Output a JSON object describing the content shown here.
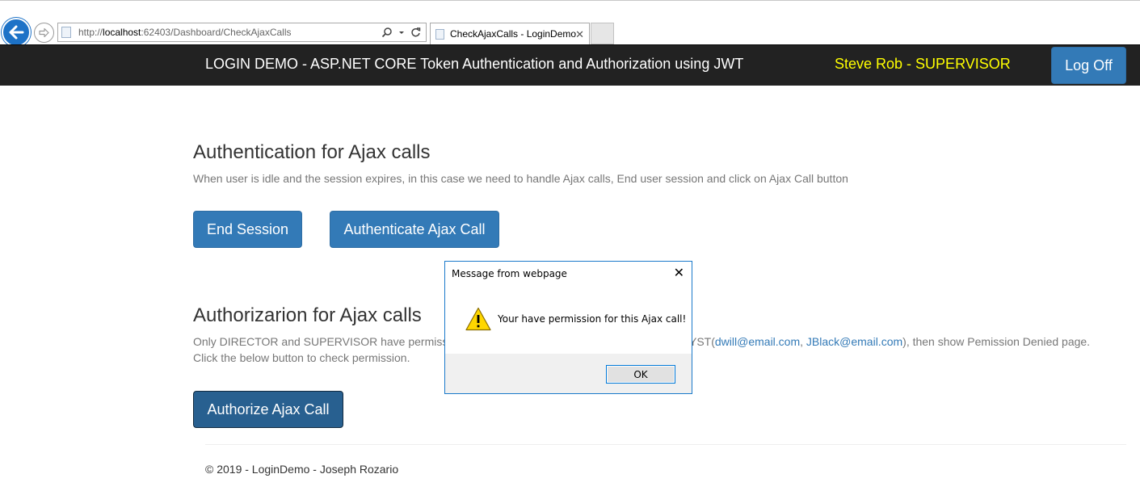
{
  "browser": {
    "url_prefix": "http://",
    "url_host": "localhost",
    "url_rest": ":62403/Dashboard/CheckAjaxCalls",
    "tab_title": "CheckAjaxCalls - LoginDemo",
    "tab_close": "✕",
    "icons": [
      "back-arrow-icon",
      "forward-arrow-icon",
      "page-icon",
      "search-icon",
      "dropdown-icon",
      "refresh-icon"
    ]
  },
  "navbar": {
    "brand": "LOGIN DEMO - ASP.NET CORE Token Authentication and Authorization using JWT",
    "user": "Steve Rob - SUPERVISOR",
    "logoff": "Log Off",
    "colors": {
      "background": "#222222",
      "user": "#ffff00",
      "button": "#337ab7"
    }
  },
  "authentication": {
    "heading": "Authentication for Ajax calls",
    "description": "When user is idle and the session expires, in this case we need to handle Ajax calls, End user session and click on Ajax Call button",
    "end_session_button": "End Session",
    "authenticate_button": "Authenticate Ajax Call"
  },
  "authorization": {
    "heading": "Authorizarion for Ajax calls",
    "desc_start": "Only DIRECTOR and SUPERVISOR have permiss",
    "desc_mid": "YST(",
    "link1": "dwill@email.com",
    "comma": ", ",
    "link2": "JBlack@email.com",
    "desc_end": "), then show Pemission Denied page.",
    "desc_line2": "Click the below button to check permission.",
    "authorize_button": "Authorize Ajax Call"
  },
  "footer": {
    "text": "© 2019 - LoginDemo - Joseph Rozario"
  },
  "dialog": {
    "title": "Message from webpage",
    "close": "✕",
    "message": "Your have permission for this Ajax call!",
    "ok": "OK",
    "icon": "warning-icon"
  }
}
